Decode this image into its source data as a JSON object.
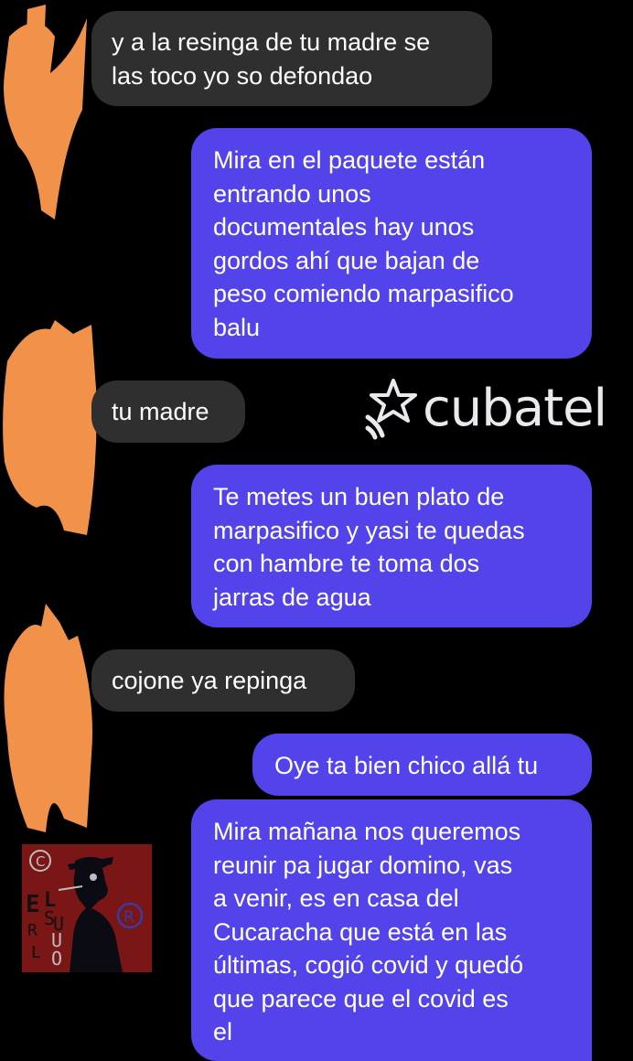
{
  "messages": [
    {
      "side": "received",
      "text": "y a la resinga de tu madre se\nlas toco yo so defondao"
    },
    {
      "side": "sent",
      "text": "Mira en el paquete están\nentrando unos\ndocumentales hay unos\ngordos ahí que bajan de\npeso comiendo marpasifico\nbalu"
    },
    {
      "side": "received",
      "text": "tu madre"
    },
    {
      "side": "sent",
      "text": "Te metes un buen plato de\nmarpasifico y yasi te quedas\ncon hambre te toma dos\njarras de agua"
    },
    {
      "side": "received",
      "text": "cojone ya repinga"
    },
    {
      "side": "sent",
      "text": "Oye ta bien chico allá tu"
    },
    {
      "side": "sent",
      "text": "Mira mañana nos queremos\nreunir pa jugar domino, vas\na venir, es en casa del\nCucaracha que está en las\núltimas, cogió covid y quedó\nque parece que el covid es\nel"
    }
  ],
  "watermark": {
    "text": "cubatel"
  },
  "logo": {
    "letters": [
      "E",
      "L",
      "R",
      "S",
      "L",
      "U",
      "U",
      "O"
    ]
  },
  "colors": {
    "background": "#000000",
    "received_bubble": "#2f2f2f",
    "sent_bubble": "#5343ea",
    "scribble": "#f2924a",
    "logo_bg": "#7a1616"
  }
}
